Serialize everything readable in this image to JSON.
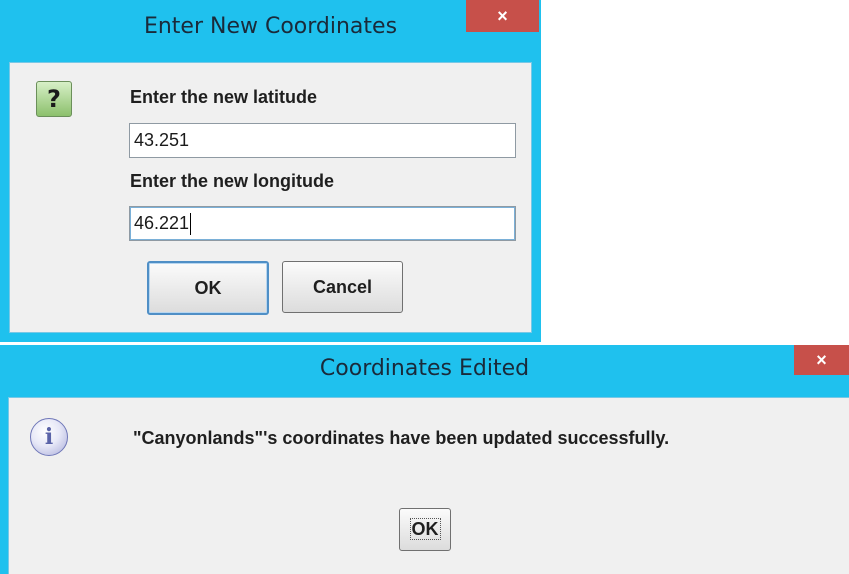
{
  "dialog1": {
    "title": "Enter New Coordinates",
    "close_glyph": "×",
    "icon": "question-icon",
    "icon_glyph": "?",
    "latitude_label": "Enter the new latitude",
    "latitude_value": "43.251",
    "longitude_label": "Enter the new longitude",
    "longitude_value": "46.221",
    "ok_label": "OK",
    "cancel_label": "Cancel"
  },
  "dialog2": {
    "title": "Coordinates Edited",
    "close_glyph": "×",
    "icon": "information-icon",
    "icon_glyph": "i",
    "message": "\"Canyonlands\"'s coordinates have been updated successfully.",
    "ok_label": "OK"
  },
  "colors": {
    "titlebar": "#1fc1ee",
    "close_button": "#c7504a",
    "dialog_body": "#f0f0f0"
  }
}
